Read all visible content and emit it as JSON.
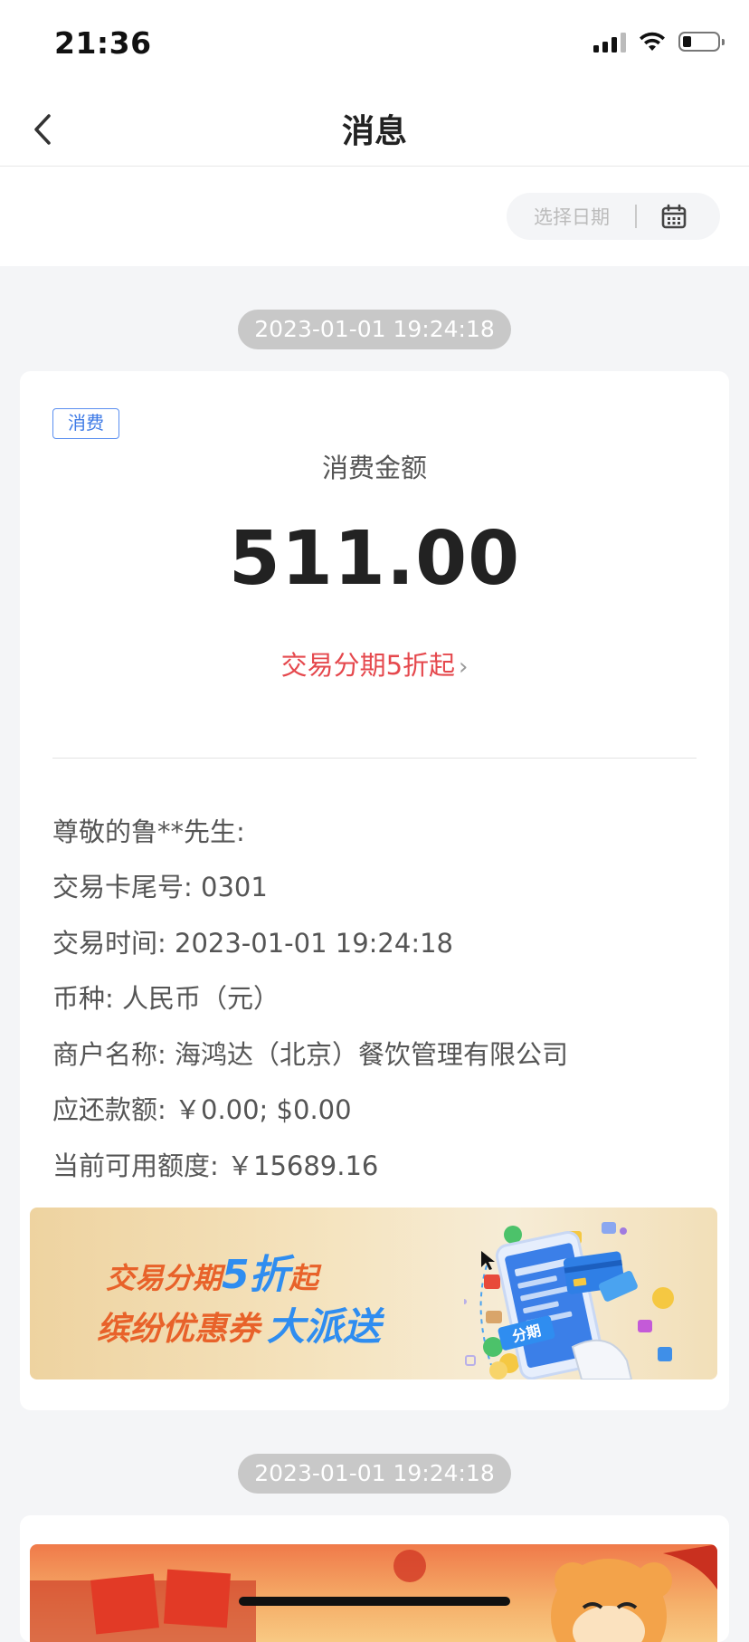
{
  "status_bar": {
    "time": "21:36"
  },
  "nav": {
    "title": "消息"
  },
  "filter": {
    "date_placeholder": "选择日期"
  },
  "messages": [
    {
      "timestamp": "2023-01-01 19:24:18",
      "tag": "消费",
      "amount_label": "消费金额",
      "amount": "511.00",
      "promo_link": "交易分期5折起",
      "details": [
        "尊敬的鲁**先生:",
        "交易卡尾号: 0301",
        "交易时间: 2023-01-01 19:24:18",
        "币种: 人民币（元）",
        "商户名称: 海鸿达（北京）餐饮管理有限公司",
        "应还款额: ￥0.00; $0.00",
        "当前可用额度: ￥15689.16"
      ],
      "banner": {
        "line1_prefix": "交易分期",
        "line1_highlight": "5折",
        "line1_suffix": "起",
        "line2_prefix": "缤纷优惠券",
        "line2_highlight": "大派送",
        "badge": "分期"
      }
    },
    {
      "timestamp": "2023-01-01 19:24:18"
    }
  ],
  "colors": {
    "accent_red": "#e5484d",
    "tag_blue": "#3d7ae6",
    "banner_orange": "#e8622a",
    "banner_blue": "#2f8df0"
  }
}
